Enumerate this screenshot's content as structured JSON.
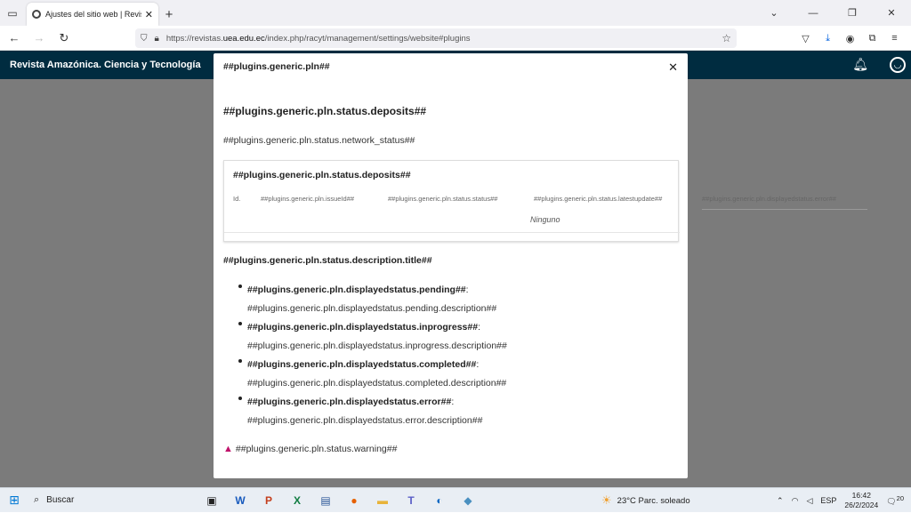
{
  "browser": {
    "tab_title": "Ajustes del sitio web | Revista A",
    "url_prefix": "https://revistas.",
    "url_domain": "uea.edu.ec",
    "url_path": "/index.php/racyt/management/settings/website#plugins"
  },
  "app": {
    "brand": "Revista Amazónica. Ciencia y Tecnología"
  },
  "modal": {
    "title": "##plugins.generic.pln##",
    "deposits_heading": "##plugins.generic.pln.status.deposits##",
    "network_status": "##plugins.generic.pln.status.network_status##",
    "panel": {
      "title": "##plugins.generic.pln.status.deposits##",
      "columns": [
        "Id.",
        "##plugins.generic.pln.issueId##",
        "##plugins.generic.pln.status.status##",
        "##plugins.generic.pln.status.latestupdate##",
        "##plugins.generic.pln.displayedstatus.error##"
      ],
      "empty": "Ninguno"
    },
    "description_title": "##plugins.generic.pln.status.description.title##",
    "statuses": [
      {
        "name": "##plugins.generic.pln.displayedstatus.pending##",
        "desc": "##plugins.generic.pln.displayedstatus.pending.description##"
      },
      {
        "name": "##plugins.generic.pln.displayedstatus.inprogress##",
        "desc": "##plugins.generic.pln.displayedstatus.inprogress.description##"
      },
      {
        "name": "##plugins.generic.pln.displayedstatus.completed##",
        "desc": "##plugins.generic.pln.displayedstatus.completed.description##"
      },
      {
        "name": "##plugins.generic.pln.displayedstatus.error##",
        "desc": "##plugins.generic.pln.displayedstatus.error.description##"
      }
    ],
    "warning": "##plugins.generic.pln.status.warning##"
  },
  "taskbar": {
    "search_label": "Buscar",
    "weather": "23°C  Parc. soleado",
    "lang": "ESP",
    "time": "16:42",
    "date": "26/2/2024",
    "notif_count": "20"
  },
  "colors": {
    "app_header": "#002c40",
    "backdrop": "#7b7b7b",
    "warning_icon": "#c0126a"
  }
}
